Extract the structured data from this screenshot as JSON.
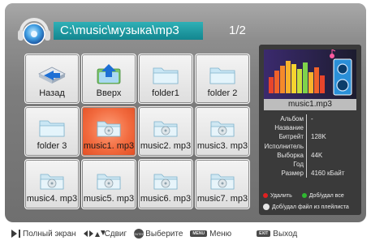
{
  "header": {
    "path": "C:\\music\\музыка\\mp3",
    "page_indicator": "1/2"
  },
  "grid": {
    "tiles": [
      {
        "label": "Назад",
        "icon": "back-arrow-icon",
        "selected": false
      },
      {
        "label": "Вверх",
        "icon": "up-arrow-icon",
        "selected": false
      },
      {
        "label": "folder1",
        "icon": "folder-icon",
        "selected": false
      },
      {
        "label": "folder 2",
        "icon": "folder-icon",
        "selected": false
      },
      {
        "label": "folder 3",
        "icon": "folder-icon",
        "selected": false
      },
      {
        "label": "music1. mp3",
        "icon": "music-file-icon",
        "selected": true
      },
      {
        "label": "music2. mp3",
        "icon": "music-file-icon",
        "selected": false
      },
      {
        "label": "music3. mp3",
        "icon": "music-file-icon",
        "selected": false
      },
      {
        "label": "music4. mp3",
        "icon": "music-file-icon",
        "selected": false
      },
      {
        "label": "music5. mp3",
        "icon": "music-file-icon",
        "selected": false
      },
      {
        "label": "music6. mp3",
        "icon": "music-file-icon",
        "selected": false
      },
      {
        "label": "music7. mp3",
        "icon": "music-file-icon",
        "selected": false
      }
    ]
  },
  "info": {
    "caption": "music1.mp3",
    "properties": [
      {
        "key": "Альбом",
        "value": "-"
      },
      {
        "key": "Название",
        "value": ""
      },
      {
        "key": "Битрейт",
        "value": "128K"
      },
      {
        "key": "Исполнитель",
        "value": ""
      },
      {
        "key": "Выборка",
        "value": "44K"
      },
      {
        "key": "Год",
        "value": ""
      },
      {
        "key": "Размер",
        "value": "4160 кБайт"
      }
    ],
    "legend": {
      "delete": "Удалить",
      "add_all": "Доб/удал все",
      "add_file": "Доб/удал файл из плейлиста"
    }
  },
  "bottom": {
    "fullscreen": "Полный экран",
    "move": "Сдвиг",
    "select": "Выберите",
    "menu": "Меню",
    "exit": "Выход",
    "enter_pill": "ENTER",
    "menu_pill": "MENU",
    "exit_pill": "EXIT"
  },
  "colors": {
    "accent_path": "#1b9aa2",
    "selected_tile": "#f26b3f",
    "red_key": "#e02020",
    "green_key": "#2fb830"
  }
}
